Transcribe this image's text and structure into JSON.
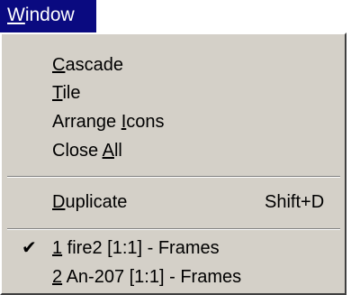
{
  "menubar": {
    "window_menu": {
      "mnemonic": "W",
      "rest": "indow"
    }
  },
  "menu": {
    "group1": [
      {
        "pre": "",
        "mnemonic": "C",
        "post": "ascade"
      },
      {
        "pre": "",
        "mnemonic": "T",
        "post": "ile"
      },
      {
        "pre": "Arrange ",
        "mnemonic": "I",
        "post": "cons"
      },
      {
        "pre": "Close ",
        "mnemonic": "A",
        "post": "ll"
      }
    ],
    "duplicate": {
      "pre": "",
      "mnemonic": "D",
      "post": "uplicate",
      "shortcut": "Shift+D"
    },
    "windows": [
      {
        "checked": true,
        "check_glyph": "✔",
        "mnemonic": "1",
        "post": " fire2 [1:1] - Frames"
      },
      {
        "checked": false,
        "check_glyph": "",
        "mnemonic": "2",
        "post": " An-207 [1:1] - Frames"
      }
    ]
  }
}
